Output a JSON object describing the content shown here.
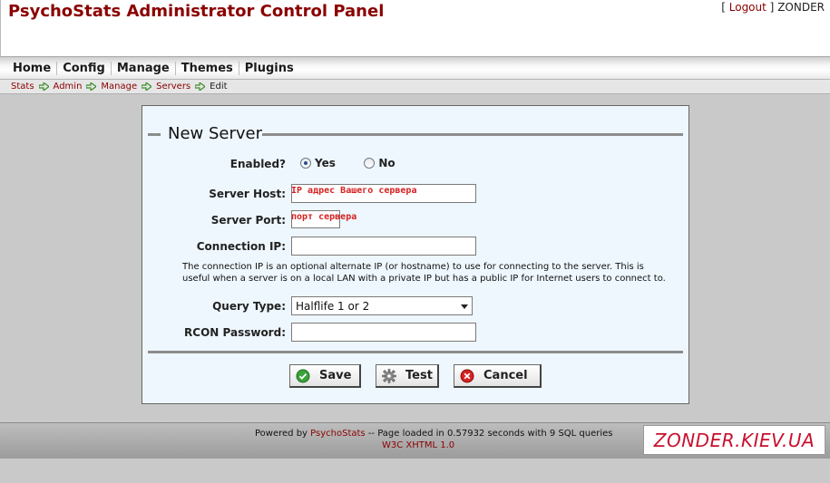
{
  "header": {
    "title": "PsychoStats Administrator Control Panel",
    "bracket_open": "[",
    "logout_label": "Logout",
    "bracket_close": "]",
    "username": "ZONDER"
  },
  "menu": {
    "items": [
      {
        "label": "Home"
      },
      {
        "label": "Config"
      },
      {
        "label": "Manage"
      },
      {
        "label": "Themes"
      },
      {
        "label": "Plugins"
      }
    ]
  },
  "breadcrumb": {
    "items": [
      {
        "label": "Stats"
      },
      {
        "label": "Admin"
      },
      {
        "label": "Manage"
      },
      {
        "label": "Servers"
      },
      {
        "label": "Edit"
      }
    ],
    "arrow_color": "#3c8c2c"
  },
  "form": {
    "legend": "New Server",
    "enabled": {
      "label": "Enabled?",
      "yes_label": "Yes",
      "no_label": "No",
      "selected": "Yes"
    },
    "server_host": {
      "label": "Server Host:",
      "value": "",
      "annotation": "IP адрес Вашего сервера"
    },
    "server_port": {
      "label": "Server Port:",
      "value": "",
      "annotation": "порт сервера"
    },
    "connection_ip": {
      "label": "Connection IP:",
      "value": "",
      "help": "The connection IP is an optional alternate IP (or hostname) to use for connecting to the server. This is useful when a server is on a local LAN with a private IP but has a public IP for Internet users to connect to."
    },
    "query_type": {
      "label": "Query Type:",
      "selected": "Halflife 1 or 2"
    },
    "rcon_password": {
      "label": "RCON Password:",
      "value": ""
    },
    "buttons": {
      "save_label": "Save",
      "test_label": "Test",
      "cancel_label": "Cancel"
    }
  },
  "footer": {
    "powered_prefix": "Powered by",
    "powered_link": "PsychoStats",
    "powered_suffix": "-- Page loaded in 0.57932 seconds with 9 SQL queries",
    "validator": "W3C XHTML 1.0"
  },
  "watermark": {
    "text": "ZONDER.KIEV.UA"
  },
  "colors": {
    "brand": "#8b0000",
    "panel_bg": "#eef7fd",
    "annotation": "#d62020",
    "watermark": "#c8102e"
  }
}
